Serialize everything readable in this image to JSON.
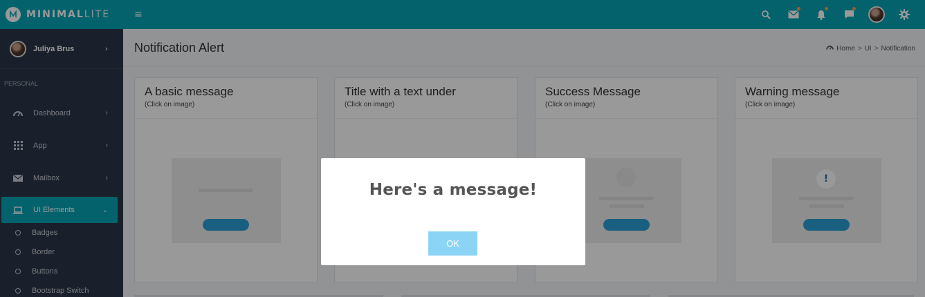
{
  "brand": {
    "name_bold": "MINIMAL",
    "name_light": "LITE"
  },
  "topbar": {
    "menu_icon": "hamburger-icon",
    "icons": [
      "search-icon",
      "mail-icon",
      "bell-icon",
      "chat-icon",
      "avatar",
      "gear-icon"
    ]
  },
  "sidebar": {
    "user_name": "Juliya Brus",
    "section_label": "PERSONAL",
    "items": [
      {
        "label": "Dashboard",
        "icon": "dashboard-icon"
      },
      {
        "label": "App",
        "icon": "grid-icon"
      },
      {
        "label": "Mailbox",
        "icon": "mail-icon"
      },
      {
        "label": "UI Elements",
        "icon": "laptop-icon",
        "active": true
      }
    ],
    "sub_items": [
      {
        "label": "Badges"
      },
      {
        "label": "Border"
      },
      {
        "label": "Buttons"
      },
      {
        "label": "Bootstrap Switch"
      }
    ]
  },
  "page": {
    "title": "Notification Alert",
    "breadcrumb": {
      "home": "Home",
      "ui": "UI",
      "current": "Notification"
    }
  },
  "cards": [
    {
      "title": "A basic message",
      "subtitle": "(Click on image)"
    },
    {
      "title": "Title with a text under",
      "subtitle": "(Click on image)"
    },
    {
      "title": "Success Message",
      "subtitle": "(Click on image)"
    },
    {
      "title": "Warning message",
      "subtitle": "(Click on image)"
    }
  ],
  "modal": {
    "title": "Here's a message!",
    "button": "OK"
  },
  "colors": {
    "accent": "#06a3b5",
    "sidebar": "#2c3648",
    "modal_button": "#8cd4f5",
    "preview_button": "#2a9fd6"
  }
}
